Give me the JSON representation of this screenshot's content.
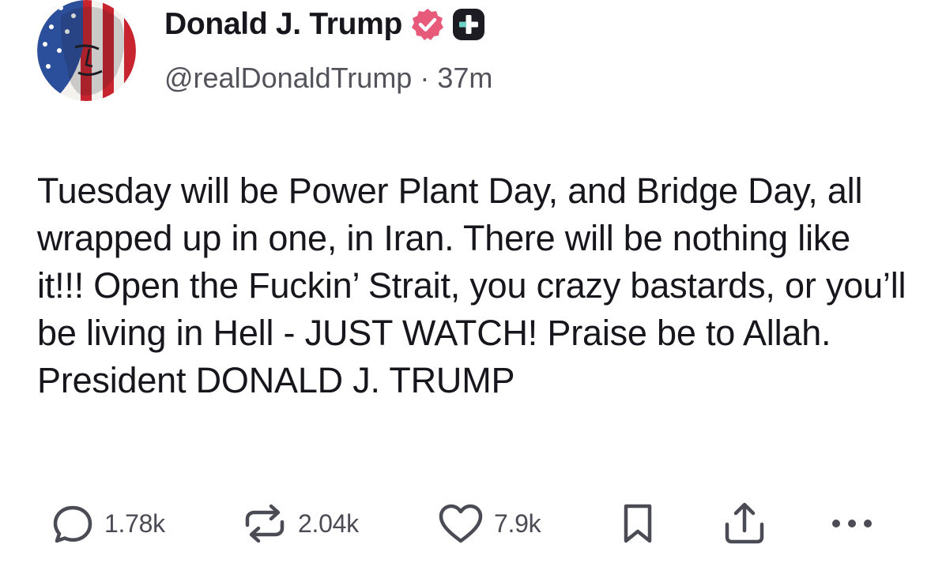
{
  "author": {
    "display_name": "Donald J. Trump",
    "handle": "@realDonaldTrump",
    "separator": "·",
    "timestamp": "37m",
    "verified": true,
    "badges": [
      "verified-badge-icon",
      "plus-badge-icon"
    ]
  },
  "post": {
    "text": "Tuesday will be Power Plant Day, and Bridge Day, all wrapped up in one, in Iran. There will be nothing like it!!! Open the Fuckin’ Strait, you crazy bastards, or you’ll be living in Hell - JUST WATCH! Praise be to Allah. President DONALD J. TRUMP"
  },
  "actions": {
    "reply_count": "1.78k",
    "repost_count": "2.04k",
    "like_count": "7.9k"
  },
  "icons": {
    "reply": "speech-bubble-icon",
    "repost": "repost-arrows-icon",
    "like": "heart-icon",
    "bookmark": "bookmark-icon",
    "share": "share-upload-icon",
    "more": "more-dots-icon"
  },
  "colors": {
    "text": "#16161c",
    "secondary_text": "#53535c",
    "icon": "#4b4b55",
    "verified_badge": "#e85a7a",
    "plus_badge": "#1c1c22",
    "background": "#ffffff"
  }
}
